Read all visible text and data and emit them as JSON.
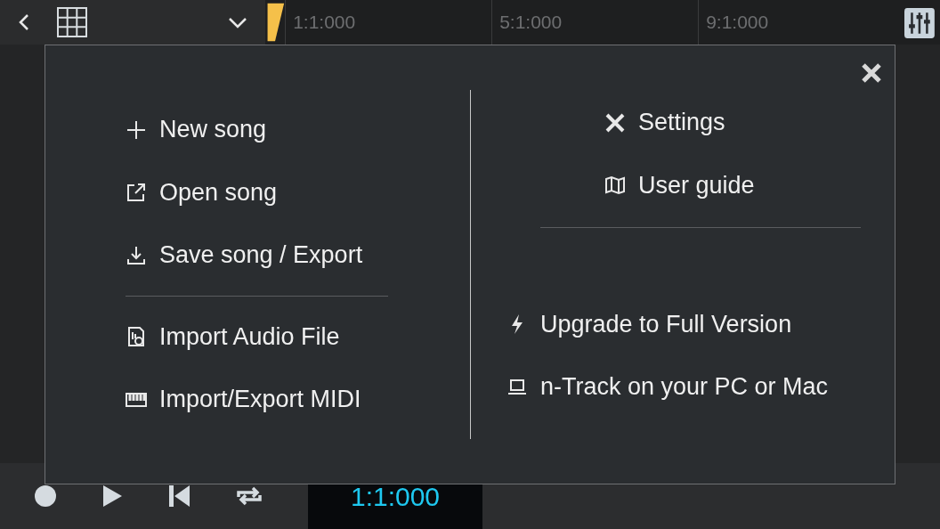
{
  "ruler": {
    "marks": [
      "1:1:000",
      "5:1:000",
      "9:1:000"
    ]
  },
  "menu": {
    "left_items": [
      {
        "kind": "new",
        "label": "New song"
      },
      {
        "kind": "open",
        "label": "Open song"
      },
      {
        "kind": "save",
        "label": "Save song / Export"
      },
      {
        "kind": "divider"
      },
      {
        "kind": "audio",
        "label": "Import Audio File"
      },
      {
        "kind": "midi",
        "label": "Import/Export MIDI"
      }
    ],
    "right_top": [
      {
        "kind": "settings",
        "label": "Settings"
      },
      {
        "kind": "guide",
        "label": "User guide"
      }
    ],
    "right_bottom": [
      {
        "kind": "upgrade",
        "label": "Upgrade to Full Version"
      },
      {
        "kind": "pc",
        "label": "n-Track on your PC or Mac"
      }
    ]
  },
  "transport": {
    "time": "1:1:000"
  }
}
